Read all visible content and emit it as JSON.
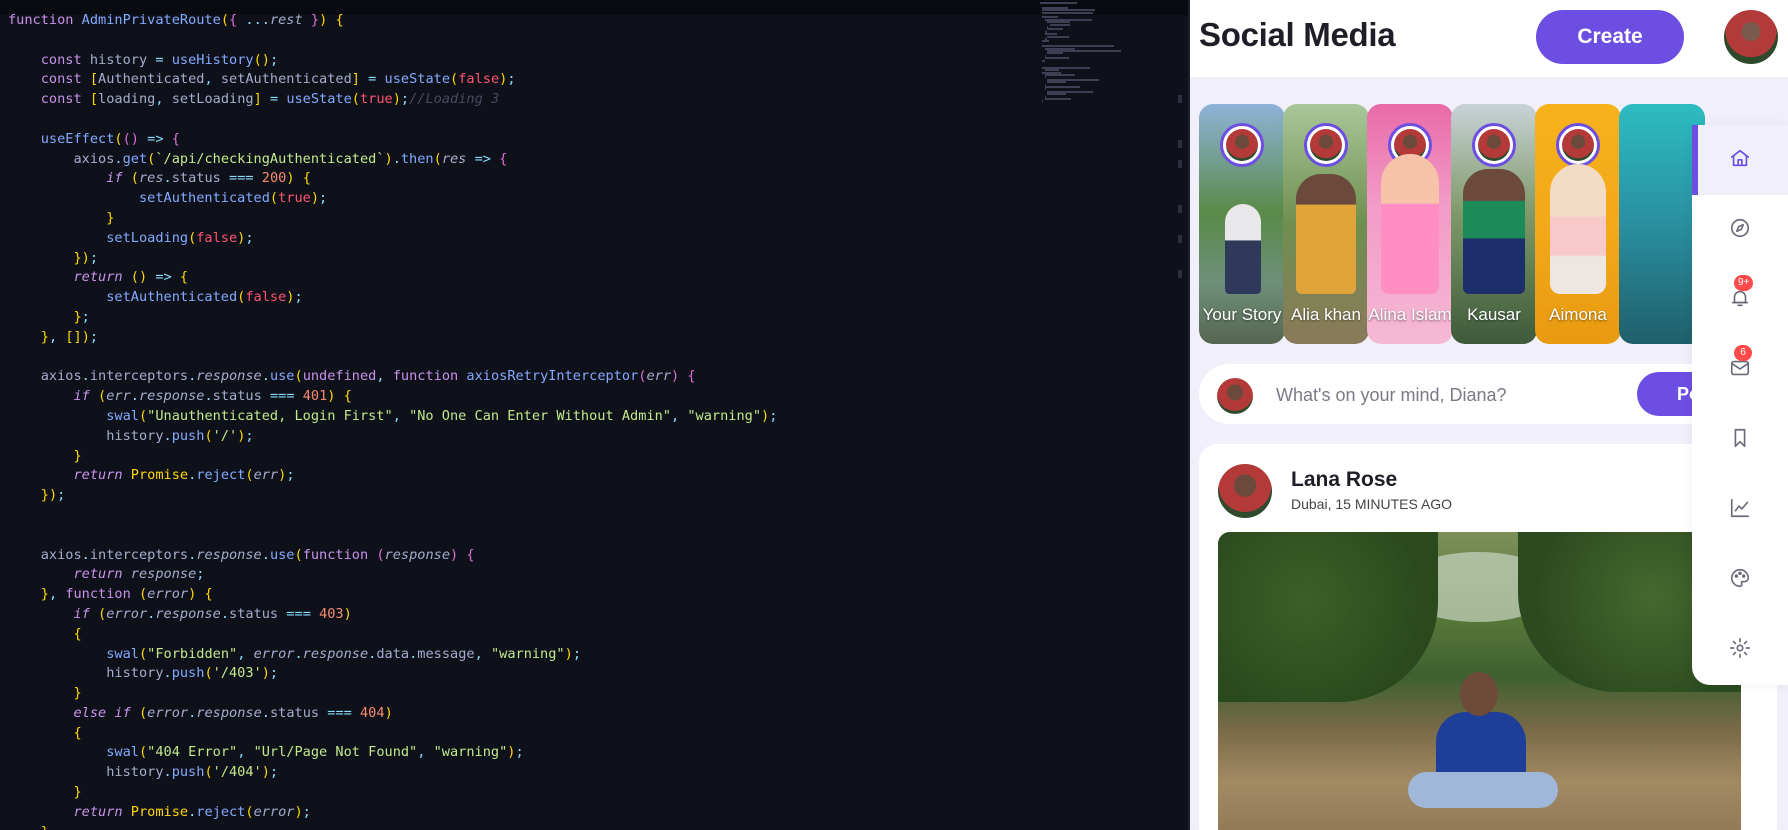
{
  "editor": {
    "code_lines": [
      "function AdminPrivateRoute({ ...rest }) {",
      "",
      "    const history = useHistory();",
      "    const [Authenticated, setAuthenticated] = useState(false);",
      "    const [loading, setLoading] = useState(true);//Loading 3",
      "",
      "    useEffect(() => {",
      "        axios.get(`/api/checkingAuthenticated`).then(res => {",
      "            if (res.status === 200) {",
      "                setAuthenticated(true);",
      "            }",
      "            setLoading(false);",
      "        });",
      "        return () => {",
      "            setAuthenticated(false);",
      "        };",
      "    }, []);",
      "",
      "    axios.interceptors.response.use(undefined, function axiosRetryInterceptor(err) {",
      "        if (err.response.status === 401) {",
      "            swal(\"Unauthenticated, Login First\", \"No One Can Enter Without Admin\", \"warning\");",
      "            history.push('/');",
      "        }",
      "        return Promise.reject(err);",
      "    });",
      "",
      "",
      "    axios.interceptors.response.use(function (response) {",
      "        return response;",
      "    }, function (error) {",
      "        if (error.response.status === 403)",
      "        {",
      "            swal(\"Forbidden\", error.response.data.message, \"warning\");",
      "            history.push('/403');",
      "        }",
      "        else if (error.response.status === 404)",
      "        {",
      "            swal(\"404 Error\", \"Url/Page Not Found\", \"warning\");",
      "            history.push('/404');",
      "        }",
      "        return Promise.reject(error);",
      "    }"
    ]
  },
  "app": {
    "title": "Social Media",
    "create_label": "Create",
    "stories": [
      {
        "name": "Your Story"
      },
      {
        "name": "Alia khan"
      },
      {
        "name": "Alina Islam"
      },
      {
        "name": "Kausar"
      },
      {
        "name": "Aimona"
      },
      {
        "name": ""
      }
    ],
    "composer": {
      "placeholder": "What's on your mind, Diana?",
      "post_label": "Post"
    },
    "feed": [
      {
        "author": "Lana Rose",
        "meta": "Dubai, 15 MINUTES AGO"
      }
    ],
    "rail": [
      {
        "icon": "home-icon",
        "active": true
      },
      {
        "icon": "explore-icon"
      },
      {
        "icon": "notifications-icon",
        "badge": "9+"
      },
      {
        "icon": "messages-icon",
        "badge": "6"
      },
      {
        "icon": "bookmarks-icon"
      },
      {
        "icon": "analytics-icon"
      },
      {
        "icon": "theme-icon"
      },
      {
        "icon": "settings-icon"
      }
    ],
    "colors": {
      "accent": "#6c4ee3",
      "page_bg": "#f1effa",
      "badge": "#ff4b4b"
    }
  }
}
